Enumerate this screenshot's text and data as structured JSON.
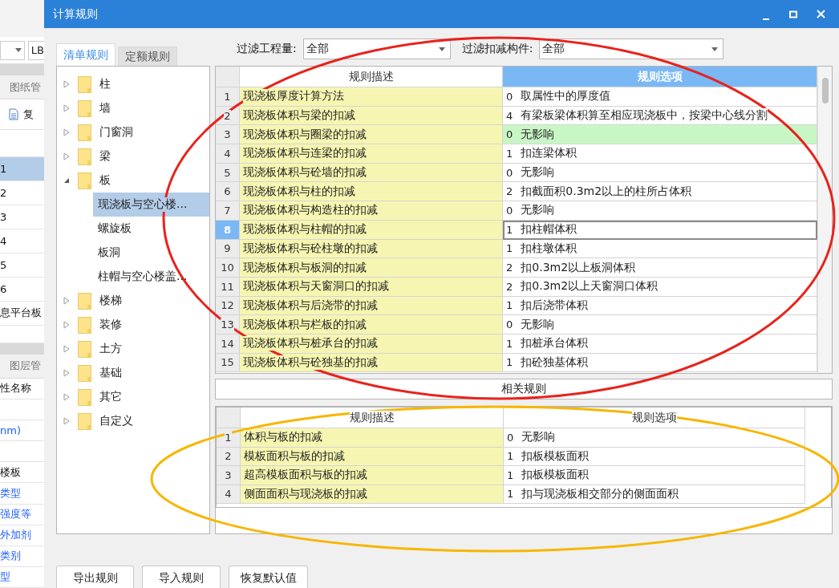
{
  "background_app": {
    "dropdown_text": "LB",
    "tab": "图纸管",
    "toolbar_button": "复",
    "list": [
      {
        "label": "1",
        "selected": true
      },
      {
        "label": "2",
        "selected": false
      },
      {
        "label": "3",
        "selected": false
      },
      {
        "label": "4",
        "selected": false
      },
      {
        "label": "5",
        "selected": false
      },
      {
        "label": "6",
        "selected": false
      },
      {
        "label": "息平台板",
        "selected": false
      }
    ],
    "tab_2": "图层管",
    "property_header": "性名称",
    "properties": [
      {
        "kind": "blank"
      },
      {
        "kind": "property",
        "label": "nm)",
        "link": true
      },
      {
        "kind": "blank"
      },
      {
        "kind": "property",
        "label": "楼板",
        "link": false
      },
      {
        "kind": "property",
        "label": "类型",
        "link": true
      },
      {
        "kind": "property",
        "label": "强度等",
        "link": true
      },
      {
        "kind": "property",
        "label": "外加剂",
        "link": true
      },
      {
        "kind": "property",
        "label": "类别",
        "link": true
      },
      {
        "kind": "property",
        "label": "型",
        "link": true
      }
    ]
  },
  "window": {
    "title": "计算规则"
  },
  "tabs": [
    {
      "label": "清单规则",
      "selected": true
    },
    {
      "label": "定额规则",
      "selected": false
    }
  ],
  "tree": [
    {
      "label": "柱",
      "expanded": false,
      "selected": false
    },
    {
      "label": "墙",
      "expanded": false,
      "selected": false
    },
    {
      "label": "门窗洞",
      "expanded": false,
      "selected": false
    },
    {
      "label": "梁",
      "expanded": false,
      "selected": false
    },
    {
      "label": "板",
      "expanded": true,
      "selected": false,
      "children": [
        {
          "label": "现浇板与空心楼...",
          "selected": true
        },
        {
          "label": "螺旋板",
          "selected": false
        },
        {
          "label": "板洞",
          "selected": false
        },
        {
          "label": "柱帽与空心楼盖...",
          "selected": false
        }
      ]
    },
    {
      "label": "楼梯",
      "expanded": false,
      "selected": false
    },
    {
      "label": "装修",
      "expanded": false,
      "selected": false
    },
    {
      "label": "土方",
      "expanded": false,
      "selected": false
    },
    {
      "label": "基础",
      "expanded": false,
      "selected": false
    },
    {
      "label": "其它",
      "expanded": false,
      "selected": false
    },
    {
      "label": "自定义",
      "expanded": false,
      "selected": false
    }
  ],
  "filters": [
    {
      "label": "过滤工程量:",
      "value": "全部"
    },
    {
      "label": "过滤扣减构件:",
      "value": "全部"
    }
  ],
  "rules_table": {
    "columns": [
      {
        "label": "规则描述",
        "selected": false
      },
      {
        "label": "规则选项",
        "selected": true
      }
    ],
    "rows": [
      {
        "num": "1",
        "description": "现浇板厚度计算方法",
        "code": "0",
        "option": "取属性中的厚度值",
        "selected": false,
        "highlighted": false
      },
      {
        "num": "2",
        "description": "现浇板体积与梁的扣减",
        "code": "4",
        "option": "有梁板梁体积算至相应现浇板中，按梁中心线分割",
        "selected": false,
        "highlighted": false
      },
      {
        "num": "3",
        "description": "现浇板体积与圈梁的扣减",
        "code": "0",
        "option": "无影响",
        "selected": false,
        "highlighted": true
      },
      {
        "num": "4",
        "description": "现浇板体积与连梁的扣减",
        "code": "1",
        "option": "扣连梁体积",
        "selected": false,
        "highlighted": false
      },
      {
        "num": "5",
        "description": "现浇板体积与砼墙的扣减",
        "code": "0",
        "option": "无影响",
        "selected": false,
        "highlighted": false
      },
      {
        "num": "6",
        "description": "现浇板体积与柱的扣减",
        "code": "2",
        "option": "扣截面积0.3m2以上的柱所占体积",
        "selected": false,
        "highlighted": false
      },
      {
        "num": "7",
        "description": "现浇板体积与构造柱的扣减",
        "code": "0",
        "option": "无影响",
        "selected": false,
        "highlighted": false
      },
      {
        "num": "8",
        "description": "现浇板体积与柱帽的扣减",
        "code": "1",
        "option": "扣柱帽体积",
        "selected": true,
        "highlighted": false
      },
      {
        "num": "9",
        "description": "现浇板体积与砼柱墩的扣减",
        "code": "1",
        "option": "扣柱墩体积",
        "selected": false,
        "highlighted": false
      },
      {
        "num": "10",
        "description": "现浇板体积与板洞的扣减",
        "code": "2",
        "option": "扣0.3m2以上板洞体积",
        "selected": false,
        "highlighted": false
      },
      {
        "num": "11",
        "description": "现浇板体积与天窗洞口的扣减",
        "code": "2",
        "option": "扣0.3m2以上天窗洞口体积",
        "selected": false,
        "highlighted": false
      },
      {
        "num": "12",
        "description": "现浇板体积与后浇带的扣减",
        "code": "1",
        "option": "扣后浇带体积",
        "selected": false,
        "highlighted": false
      },
      {
        "num": "13",
        "description": "现浇板体积与栏板的扣减",
        "code": "0",
        "option": "无影响",
        "selected": false,
        "highlighted": false
      },
      {
        "num": "14",
        "description": "现浇板体积与桩承台的扣减",
        "code": "1",
        "option": "扣桩承台体积",
        "selected": false,
        "highlighted": false
      },
      {
        "num": "15",
        "description": "现浇板体积与砼独基的扣减",
        "code": "1",
        "option": "扣砼独基体积",
        "selected": false,
        "highlighted": false
      }
    ]
  },
  "related_title": "相关规则",
  "related_table": {
    "columns": [
      {
        "label": "规则描述",
        "selected": false
      },
      {
        "label": "规则选项",
        "selected": false
      }
    ],
    "rows": [
      {
        "num": "1",
        "description": "体积与板的扣减",
        "code": "0",
        "option": "无影响",
        "selected": false,
        "highlighted": false
      },
      {
        "num": "2",
        "description": "模板面积与板的扣减",
        "code": "1",
        "option": "扣板模板面积",
        "selected": false,
        "highlighted": false
      },
      {
        "num": "3",
        "description": "超高模板面积与板的扣减",
        "code": "1",
        "option": "扣板模板面积",
        "selected": false,
        "highlighted": false
      },
      {
        "num": "4",
        "description": "侧面面积与现浇板的扣减",
        "code": "1",
        "option": "扣与现浇板相交部分的侧面面积",
        "selected": false,
        "highlighted": false
      }
    ]
  },
  "buttons": [
    "导出规则",
    "导入规则",
    "恢复默认值"
  ],
  "annotations": [
    {
      "kind": "ellipse",
      "color": "#e8231c"
    },
    {
      "kind": "ellipse",
      "color": "#f7b600"
    }
  ]
}
